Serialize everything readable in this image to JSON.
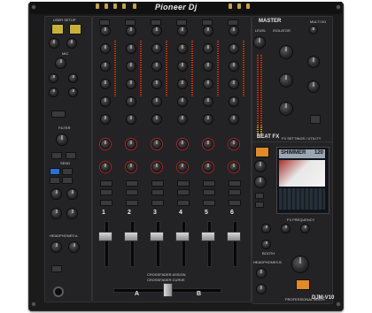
{
  "brand": {
    "logo_text": "Pioneer Dj"
  },
  "model": {
    "name": "DJM-V10",
    "subtitle": "PROFESSIONAL MIXER"
  },
  "sections": {
    "user_setup": "USER SETUP",
    "mic": "MIC",
    "filter": "FILTER",
    "send": "SEND",
    "master": "MASTER",
    "level": "LEVEL",
    "isolator": "ISOLATOR",
    "multi_io": "MULTI I/O",
    "beat_fx": "BEAT FX",
    "fx_settings": "FX SETTINGS / UTILITY",
    "fx_frequency": "FX FREQUENCY",
    "headphones_a": "HEADPHONES A",
    "headphones_b": "HEADPHONES B",
    "booth": "BOOTH",
    "phones_b": "PHONES B",
    "crossfader": "CROSSFADER ASSIGN",
    "crossfader_curve": "CROSSFADER CURVE"
  },
  "display": {
    "effect_name": "SHIMMER",
    "bpm": "120"
  },
  "channels": [
    "1",
    "2",
    "3",
    "4",
    "5",
    "6"
  ],
  "crossfader_labels": {
    "left": "A",
    "right": "B"
  },
  "colors": {
    "body": "#1b1b1c",
    "meter": "#e0401e",
    "accent_gold": "#c9b03a",
    "accent_blue": "#2a6fd1"
  }
}
